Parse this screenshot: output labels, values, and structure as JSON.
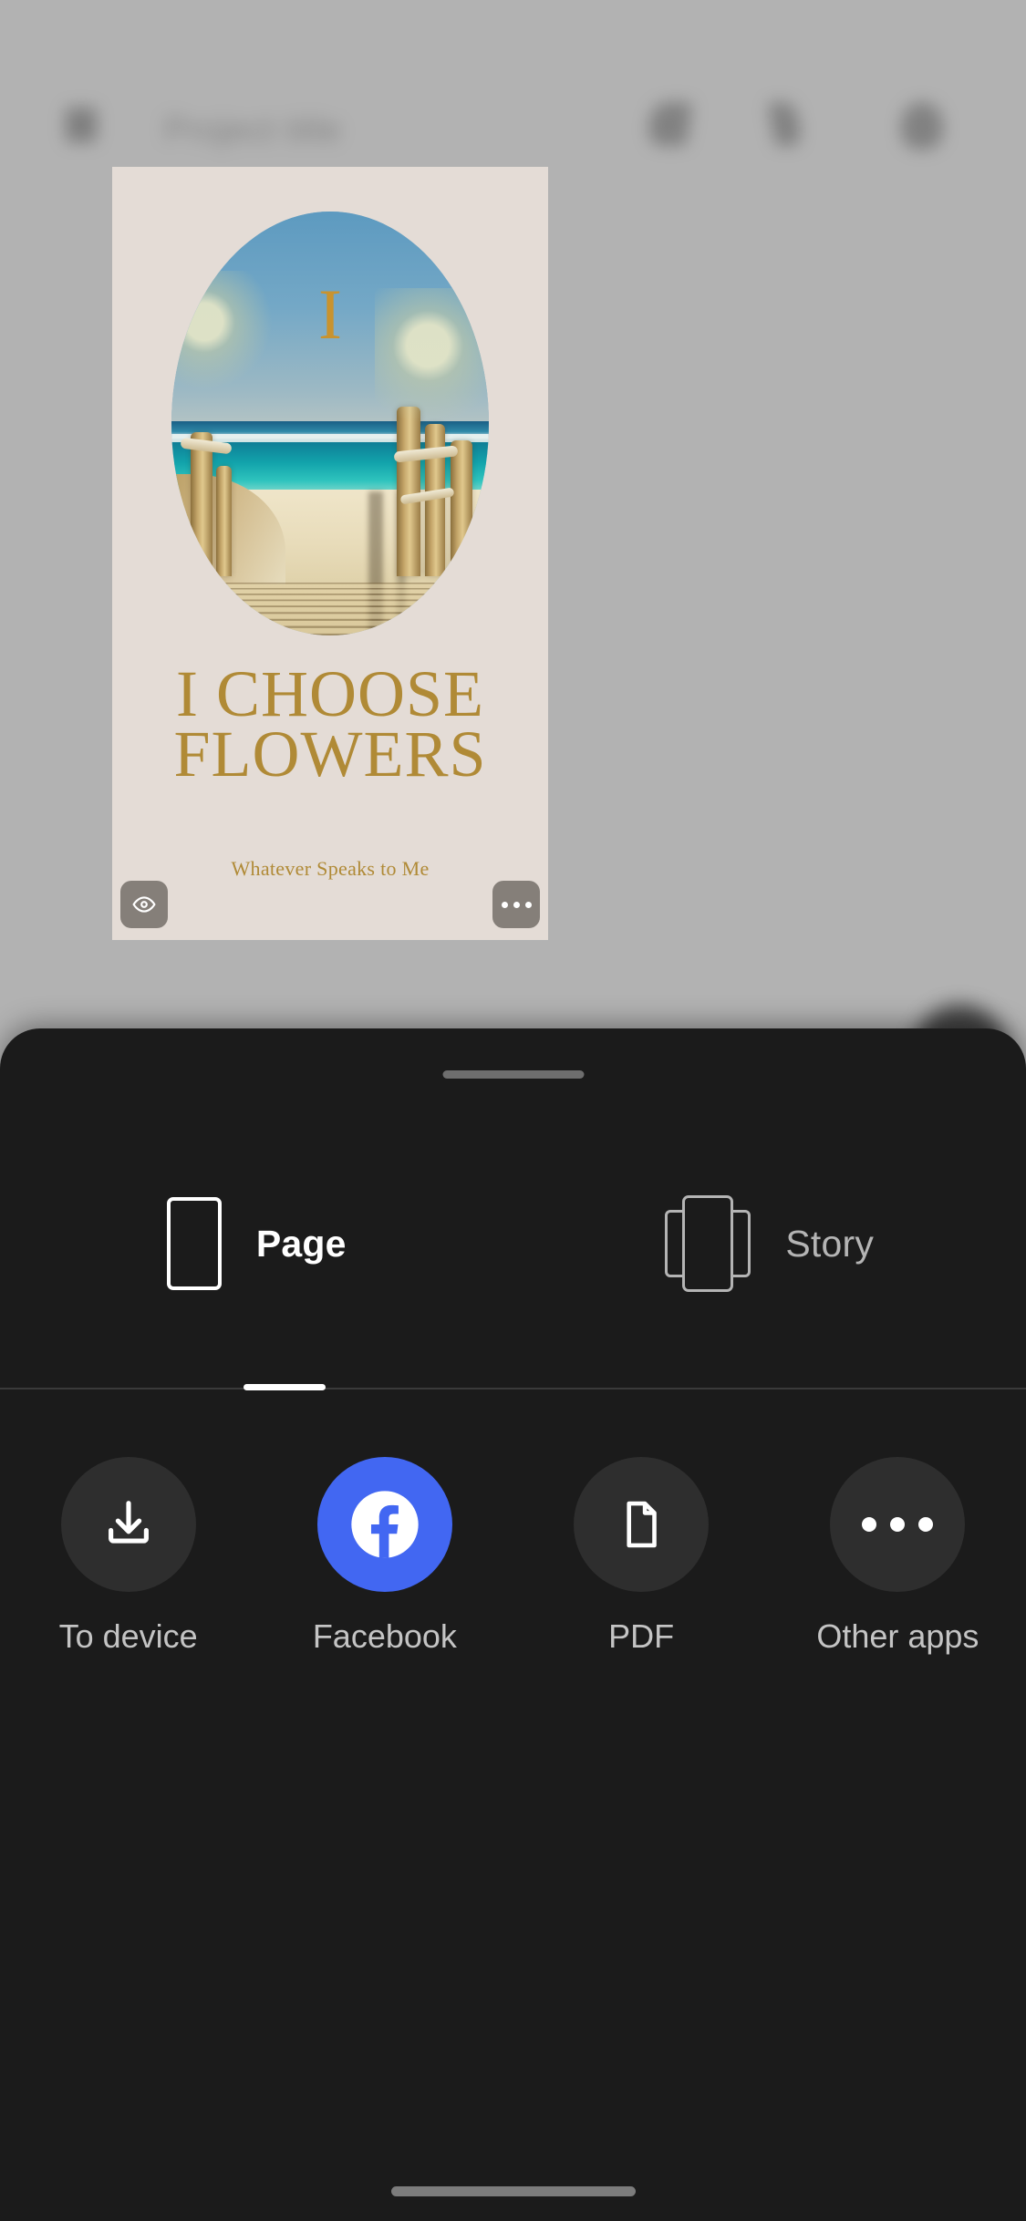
{
  "topbar": {
    "title": "Project title",
    "back_icon": "back-arrow-icon",
    "undo_icon": "undo-icon",
    "redo_icon": "redo-icon",
    "avatar_icon": "account-icon"
  },
  "canvas": {
    "monogram": "I",
    "headline": "I CHOOSE\nFLOWERS",
    "subtitle": "Whatever Speaks to Me",
    "preview_icon": "eye-icon",
    "more_icon": "more-horizontal-icon",
    "background_color": "#e4dcd6",
    "text_color": "#b08a36"
  },
  "fab": {
    "icon": "settings-icon"
  },
  "sheet": {
    "handle": "drag-handle",
    "format_tabs": [
      {
        "label": "Page",
        "icon": "page-format-icon",
        "active": true
      },
      {
        "label": "Story",
        "icon": "story-format-icon",
        "active": false
      }
    ],
    "actions": [
      {
        "label": "To device",
        "icon": "download-icon"
      },
      {
        "label": "Facebook",
        "icon": "facebook-icon",
        "color": "#4267f2"
      },
      {
        "label": "PDF",
        "icon": "document-icon"
      },
      {
        "label": "Other apps",
        "icon": "more-horizontal-icon"
      }
    ]
  }
}
